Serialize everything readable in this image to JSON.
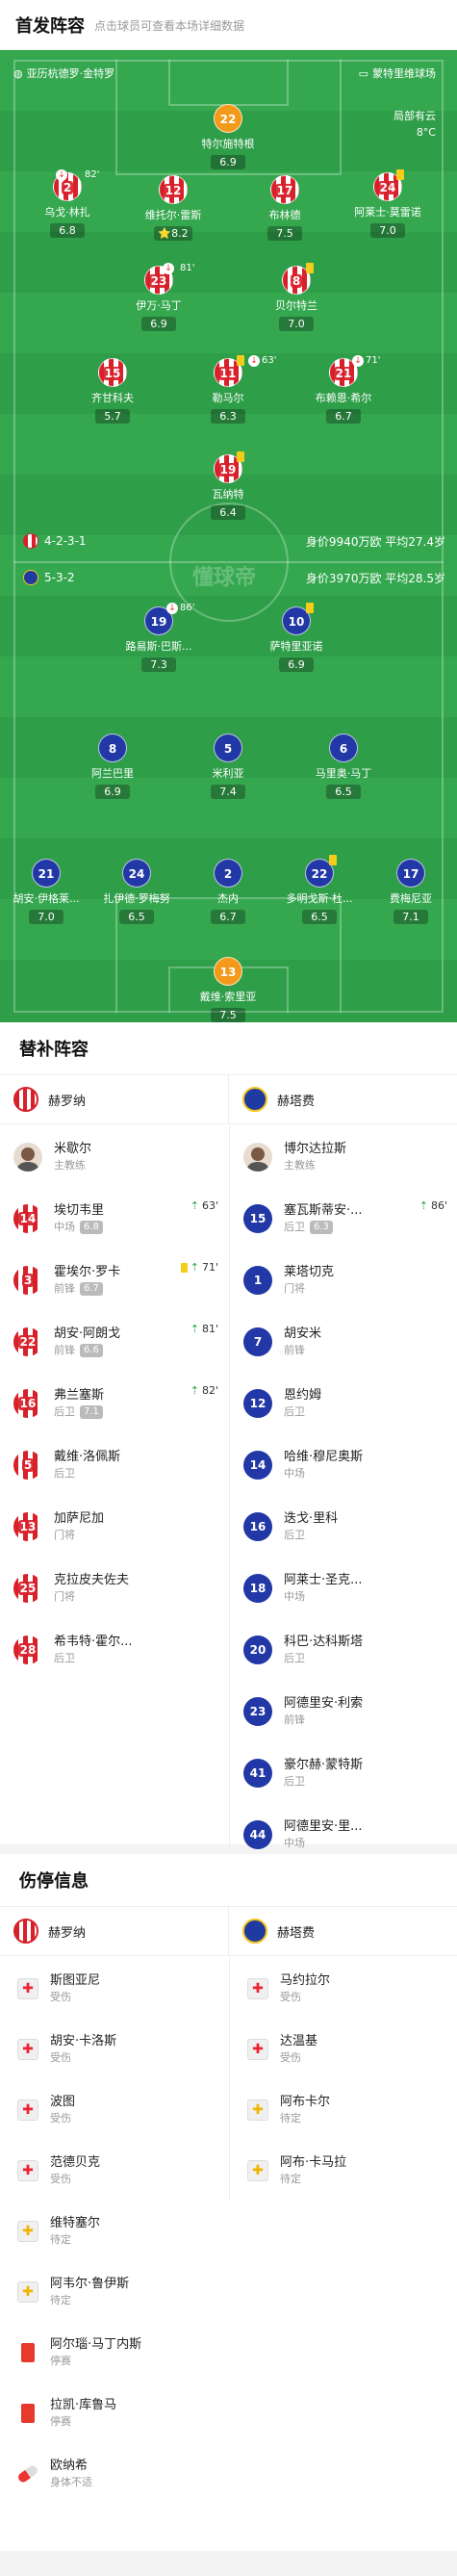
{
  "header": {
    "title": "首发阵容",
    "subtitle": "点击球员可查看本场详细数据"
  },
  "pitch": {
    "home_team": "亚历杭德罗·金特罗",
    "away_team": "蒙特里维球场",
    "weather": "局部有云",
    "temp": "8°C",
    "home_formation": "4-2-3-1",
    "home_meta": "身价9940万欧 平均27.4岁",
    "away_formation": "5-3-2",
    "away_meta": "身价3970万欧 平均28.5岁",
    "watermark": "懂球帝"
  },
  "home_players": [
    {
      "num": "22",
      "name": "特尔施特根",
      "rating": "6.9",
      "kit": "orange"
    },
    {
      "num": "2",
      "name": "乌戈·林扎",
      "rating": "6.8",
      "kit": "red",
      "evt": "82'"
    },
    {
      "num": "12",
      "name": "维托尔·雷斯",
      "rating": "8.2",
      "kit": "red",
      "star": "⭐"
    },
    {
      "num": "17",
      "name": "布林德",
      "rating": "7.5",
      "kit": "red"
    },
    {
      "num": "24",
      "name": "阿莱士·莫雷诺",
      "rating": "7.0",
      "kit": "red"
    },
    {
      "num": "23",
      "name": "伊万·马丁",
      "rating": "6.9",
      "kit": "red",
      "evt": "81'"
    },
    {
      "num": "8",
      "name": "贝尔特兰",
      "rating": "7.0",
      "kit": "red"
    },
    {
      "num": "15",
      "name": "齐甘科夫",
      "rating": "5.7",
      "kit": "red"
    },
    {
      "num": "11",
      "name": "勒马尔",
      "rating": "6.3",
      "kit": "red",
      "evt": "63'"
    },
    {
      "num": "21",
      "name": "布赖恩·希尔",
      "rating": "6.7",
      "kit": "red",
      "evt": "71'"
    },
    {
      "num": "19",
      "name": "瓦纳特",
      "rating": "6.4",
      "kit": "red"
    }
  ],
  "away_players": [
    {
      "num": "19",
      "name": "路易斯·巴斯...",
      "rating": "7.3",
      "kit": "blue",
      "evt": "86'"
    },
    {
      "num": "10",
      "name": "萨特里亚诺",
      "rating": "6.9",
      "kit": "blue"
    },
    {
      "num": "8",
      "name": "阿兰巴里",
      "rating": "6.9",
      "kit": "blue"
    },
    {
      "num": "5",
      "name": "米利亚",
      "rating": "7.4",
      "kit": "blue"
    },
    {
      "num": "6",
      "name": "马里奥·马丁",
      "rating": "6.5",
      "kit": "blue"
    },
    {
      "num": "21",
      "name": "胡安·伊格莱...",
      "rating": "7.0",
      "kit": "blue"
    },
    {
      "num": "24",
      "name": "扎伊德·罗梅努",
      "rating": "6.5",
      "kit": "blue"
    },
    {
      "num": "2",
      "name": "杰内",
      "rating": "6.7",
      "kit": "blue"
    },
    {
      "num": "22",
      "name": "多明戈斯·杜...",
      "rating": "6.5",
      "kit": "blue"
    },
    {
      "num": "17",
      "name": "费梅尼亚",
      "rating": "7.1",
      "kit": "blue"
    },
    {
      "num": "13",
      "name": "戴维·索里亚",
      "rating": "7.5",
      "kit": "orange"
    }
  ],
  "subs": {
    "title": "替补阵容",
    "home_team": "赫罗纳",
    "away_team": "赫塔费",
    "home": [
      {
        "num": "",
        "name": "米歇尔",
        "pos": "主教练",
        "coach": true
      },
      {
        "num": "14",
        "name": "埃切韦里",
        "pos": "中场",
        "rating": "6.8",
        "evt": "63'"
      },
      {
        "num": "3",
        "name": "霍埃尔·罗卡",
        "pos": "前锋",
        "rating": "6.7",
        "evt": "71'",
        "yc": true
      },
      {
        "num": "22",
        "name": "胡安·阿朗戈",
        "pos": "前锋",
        "rating": "6.6",
        "evt": "81'"
      },
      {
        "num": "16",
        "name": "弗兰塞斯",
        "pos": "后卫",
        "rating": "7.1",
        "evt": "82'"
      },
      {
        "num": "5",
        "name": "戴维·洛佩斯",
        "pos": "后卫"
      },
      {
        "num": "13",
        "name": "加萨尼加",
        "pos": "门将"
      },
      {
        "num": "25",
        "name": "克拉皮夫佐夫",
        "pos": "门将"
      },
      {
        "num": "28",
        "name": "希韦特·霍尔...",
        "pos": "后卫"
      }
    ],
    "away": [
      {
        "num": "",
        "name": "博尔达拉斯",
        "pos": "主教练",
        "coach": true
      },
      {
        "num": "15",
        "name": "塞瓦斯蒂安·...",
        "pos": "后卫",
        "rating": "6.3",
        "evt": "86'"
      },
      {
        "num": "1",
        "name": "莱塔切克",
        "pos": "门将"
      },
      {
        "num": "7",
        "name": "胡安米",
        "pos": "前锋"
      },
      {
        "num": "12",
        "name": "恩约姆",
        "pos": "后卫"
      },
      {
        "num": "14",
        "name": "哈维·穆尼奥斯",
        "pos": "中场"
      },
      {
        "num": "16",
        "name": "迭戈·里科",
        "pos": "后卫"
      },
      {
        "num": "18",
        "name": "阿莱士·圣克...",
        "pos": "中场"
      },
      {
        "num": "20",
        "name": "科巴·达科斯塔",
        "pos": "后卫"
      },
      {
        "num": "23",
        "name": "阿德里安·利索",
        "pos": "前锋"
      },
      {
        "num": "41",
        "name": "豪尔赫·蒙特斯",
        "pos": "后卫"
      },
      {
        "num": "44",
        "name": "阿德里安·里...",
        "pos": "中场"
      }
    ]
  },
  "injuries": {
    "title": "伤停信息",
    "home_team": "赫罗纳",
    "away_team": "赫塔费",
    "home": [
      {
        "name": "斯图亚尼",
        "status": "受伤",
        "type": "kit-red"
      },
      {
        "name": "胡安·卡洛斯",
        "status": "受伤",
        "type": "kit-red"
      },
      {
        "name": "波图",
        "status": "受伤",
        "type": "kit-red"
      },
      {
        "name": "范德贝克",
        "status": "受伤",
        "type": "kit-red"
      },
      {
        "name": "维特塞尔",
        "status": "待定",
        "type": "kit-yellow"
      },
      {
        "name": "阿韦尔·鲁伊斯",
        "status": "待定",
        "type": "kit-yellow"
      },
      {
        "name": "阿尔瑙·马丁内斯",
        "status": "停赛",
        "type": "red-card"
      },
      {
        "name": "拉凯·库鲁马",
        "status": "停赛",
        "type": "red-card"
      },
      {
        "name": "欧纳希",
        "status": "身体不适",
        "type": "pill"
      }
    ],
    "away": [
      {
        "name": "马约拉尔",
        "status": "受伤",
        "type": "kit-red"
      },
      {
        "name": "达温基",
        "status": "受伤",
        "type": "kit-red"
      },
      {
        "name": "阿布卡尔",
        "status": "待定",
        "type": "kit-yellow"
      },
      {
        "name": "阿布·卡马拉",
        "status": "待定",
        "type": "kit-yellow"
      }
    ]
  }
}
